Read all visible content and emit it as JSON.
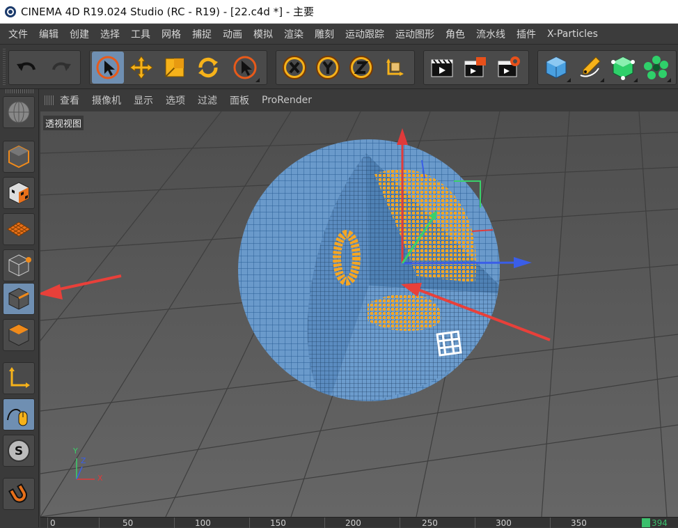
{
  "window": {
    "title": "CINEMA 4D R19.024 Studio (RC - R19) - [22.c4d *] - 主要"
  },
  "menu": [
    "文件",
    "编辑",
    "创建",
    "选择",
    "工具",
    "网格",
    "捕捉",
    "动画",
    "模拟",
    "渲染",
    "雕刻",
    "运动跟踪",
    "运动图形",
    "角色",
    "流水线",
    "插件",
    "X-Particles"
  ],
  "toolbar": {
    "icons": [
      "undo-icon",
      "redo-icon",
      "live-select-icon",
      "move-icon",
      "scale-icon",
      "rotate-icon",
      "recent-tool-icon",
      "x-axis-lock-icon",
      "y-axis-lock-icon",
      "z-axis-lock-icon",
      "coordinate-system-icon",
      "render-view-icon",
      "render-picture-viewer-icon",
      "render-settings-icon",
      "cube-object-icon",
      "pen-spline-icon",
      "subdivision-surface-icon",
      "cloner-icon"
    ]
  },
  "sidebar": {
    "icons": [
      "make-editable-icon",
      "model-mode-icon",
      "texture-mode-icon",
      "workplane-mode-icon",
      "points-mode-icon",
      "edges-mode-icon",
      "polygons-mode-icon",
      "axis-mode-icon",
      "tweak-mode-icon",
      "solo-icon",
      "snap-icon"
    ]
  },
  "view_menu": [
    "查看",
    "摄像机",
    "显示",
    "选项",
    "过滤",
    "面板",
    "ProRender"
  ],
  "viewport": {
    "label": "透视视图",
    "axis_labels": {
      "x": "X",
      "y": "Y",
      "z": "Z"
    }
  },
  "timeline": {
    "ticks": [
      "0",
      "50",
      "100",
      "150",
      "200",
      "250",
      "300",
      "350"
    ],
    "current_frame": "394"
  },
  "colors": {
    "menu_bg": "#3c3c3c",
    "active_button": "#6f8fb2",
    "sphere_wire": "#7aa8d6",
    "particles": "#f5a623",
    "x_axis": "#e03a3a",
    "y_axis": "#3ad06a",
    "z_axis": "#3a5ee8",
    "annotation_arrow": "#e8403a"
  }
}
